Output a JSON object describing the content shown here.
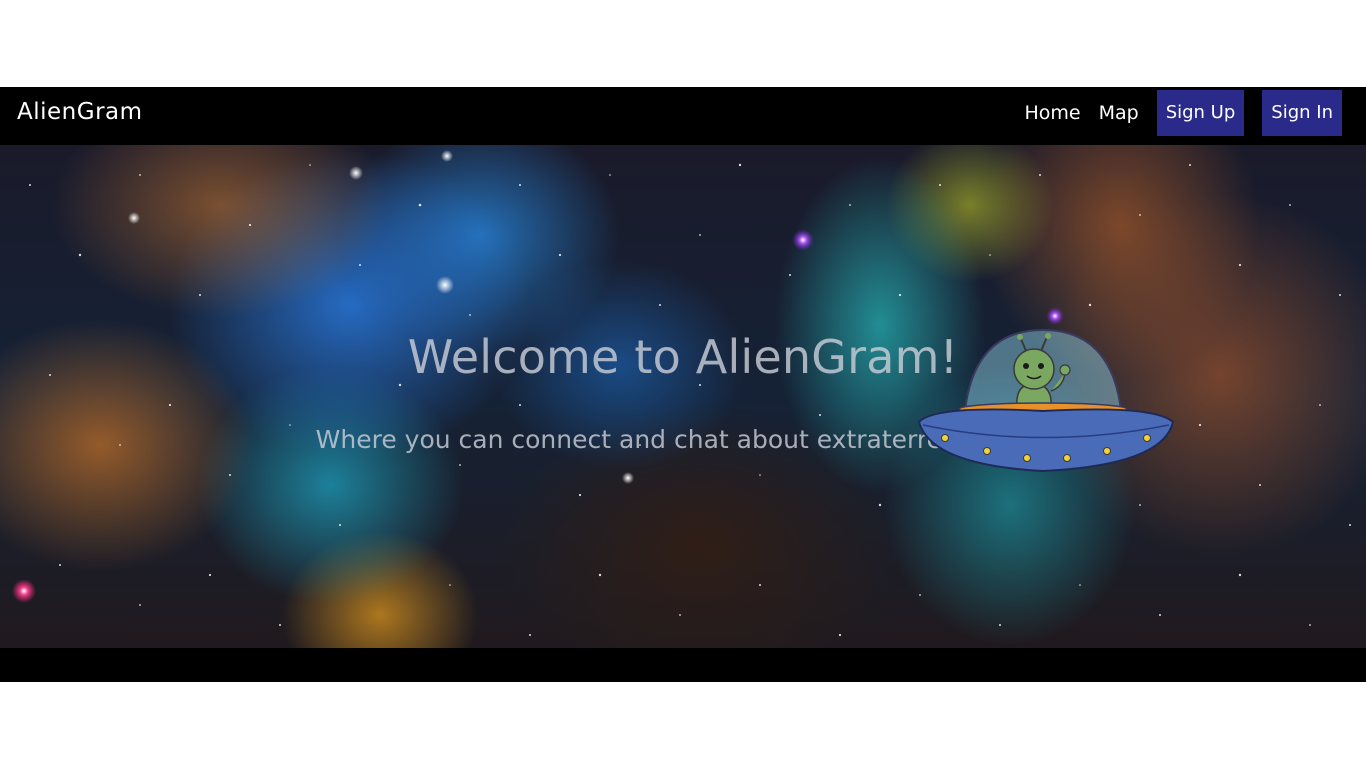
{
  "navbar": {
    "brand": "AlienGram",
    "links": [
      "Home",
      "Map"
    ],
    "signup_label": "Sign Up",
    "signin_label": "Sign In",
    "button_color": "#2a2a8a"
  },
  "hero": {
    "title": "Welcome to AlienGram!",
    "subtitle": "Where you can connect and chat about extraterrestrial life",
    "background": "space-nebula-image",
    "illustration": "alien-ufo-icon"
  }
}
